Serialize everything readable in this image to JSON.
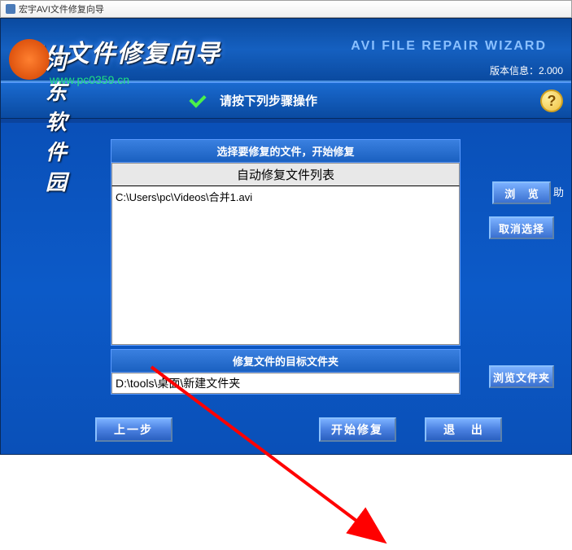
{
  "titlebar": {
    "text": "宏宇AVI文件修复向导"
  },
  "header": {
    "main_title": "AVI文件修复向导",
    "sub_title": "AVI FILE REPAIR WIZARD",
    "version_label": "版本信息：2.000"
  },
  "instruction": {
    "text": "请按下列步骤操作"
  },
  "help": {
    "symbol": "?",
    "label": "帮 助"
  },
  "panel1": {
    "header": "选择要修复的文件，开始修复",
    "list_header": "自动修复文件列表",
    "files": [
      "C:\\Users\\pc\\Videos\\合并1.avi"
    ]
  },
  "panel2": {
    "header": "修复文件的目标文件夹",
    "dest_path": "D:\\tools\\桌面\\新建文件夹"
  },
  "buttons": {
    "browse": "浏 览",
    "cancel_select": "取消选择",
    "browse_folder": "浏览文件夹",
    "prev": "上一步",
    "start_repair": "开始修复",
    "exit": "退 出"
  },
  "watermark": {
    "text": "河东软件园",
    "url": "www.pc0359.cn"
  }
}
